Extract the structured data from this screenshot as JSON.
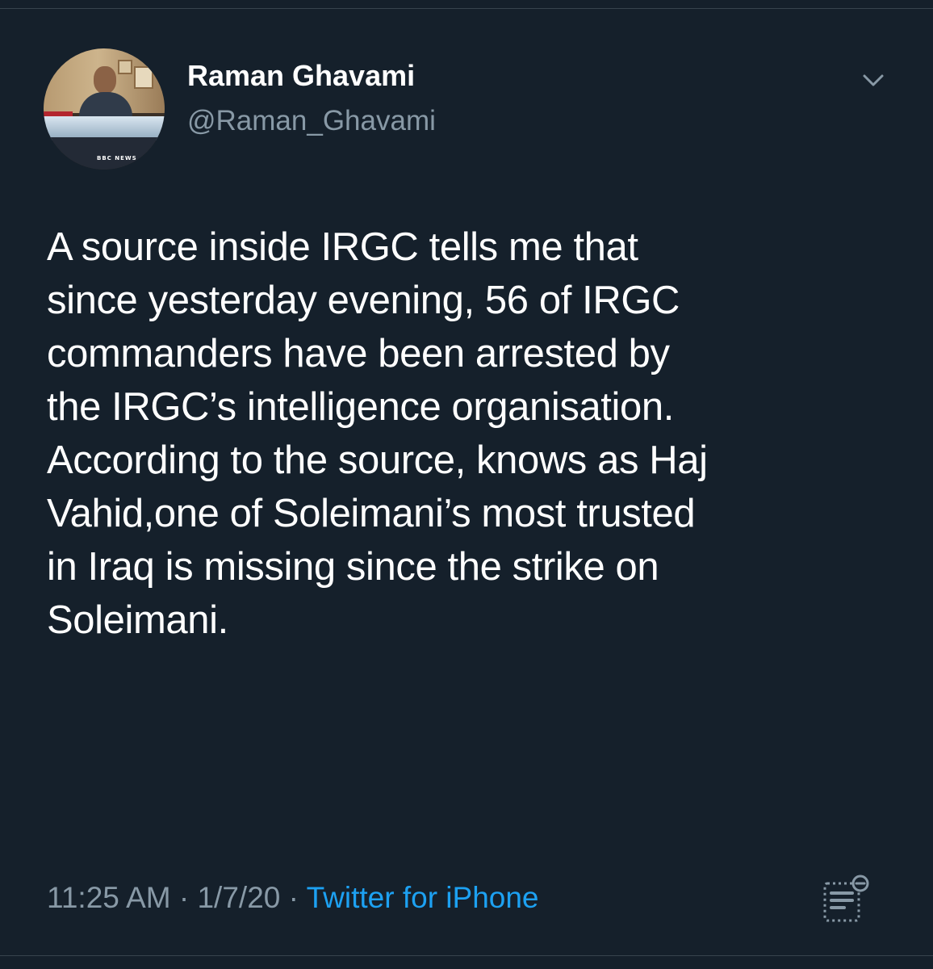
{
  "tweet": {
    "display_name": "Raman Ghavami",
    "handle": "@Raman_Ghavami",
    "text": "A source inside IRGC tells me that\nsince yesterday evening, 56 of IRGC\ncommanders have been arrested by\nthe IRGC’s intelligence organisation.\nAccording to the source, knows as Haj\nVahid,one of Soleimani’s most trusted\nin Iraq is missing since the strike on\nSoleimani.",
    "time": "11:25 AM",
    "separator": "·",
    "date": "1/7/20",
    "source": "Twitter for iPhone"
  },
  "avatar": {
    "watermark": "BBC NEWS"
  },
  "icons": {
    "menu": "chevron-down-icon",
    "analytics": "tweet-analytics-icon"
  },
  "colors": {
    "background": "#15202b",
    "text": "#ffffff",
    "secondary_text": "#8899a6",
    "link": "#1da1f2",
    "divider": "#38444d"
  }
}
